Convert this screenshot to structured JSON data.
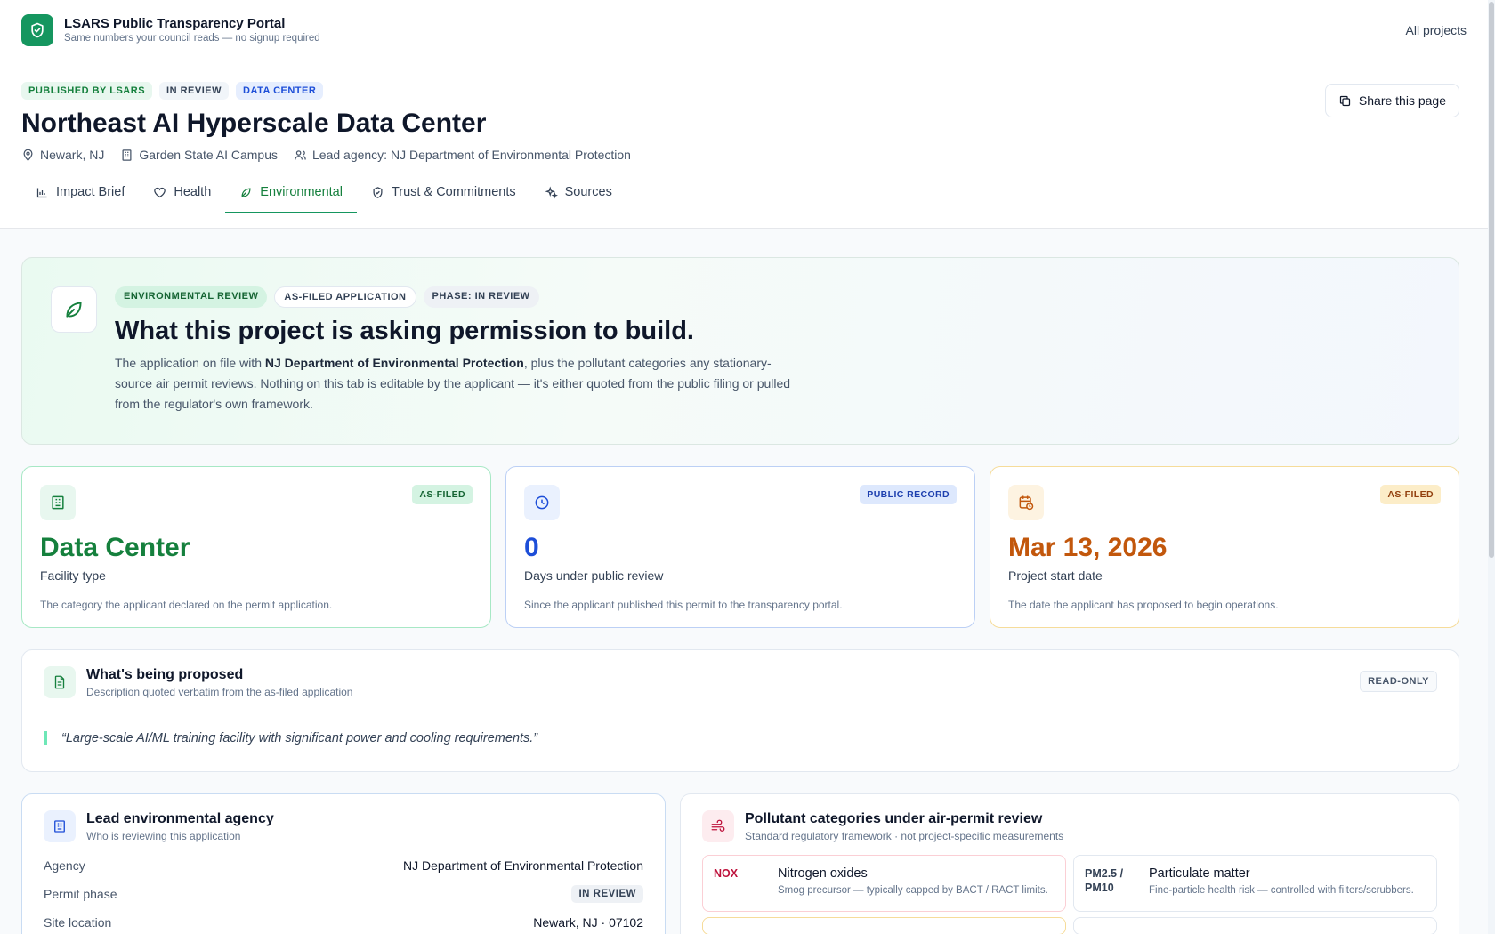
{
  "brand": {
    "title": "LSARS Public Transparency Portal",
    "subtitle": "Same numbers your council reads — no signup required"
  },
  "nav": {
    "all_projects": "All projects"
  },
  "project": {
    "badges": [
      "PUBLISHED BY LSARS",
      "IN REVIEW",
      "DATA CENTER"
    ],
    "title": "Northeast AI Hyperscale Data Center",
    "location": "Newark, NJ",
    "campus": "Garden State AI Campus",
    "lead_agency": "Lead agency: NJ Department of Environmental Protection",
    "share_label": "Share this page"
  },
  "tabs": [
    {
      "label": "Impact Brief",
      "icon": "bar-chart-icon"
    },
    {
      "label": "Health",
      "icon": "heart-icon"
    },
    {
      "label": "Environmental",
      "icon": "leaf-icon",
      "active": true
    },
    {
      "label": "Trust & Commitments",
      "icon": "shield-icon"
    },
    {
      "label": "Sources",
      "icon": "sparkles-icon"
    }
  ],
  "hero": {
    "pills": [
      "ENVIRONMENTAL REVIEW",
      "AS-FILED APPLICATION",
      "PHASE: IN REVIEW"
    ],
    "title": "What this project is asking permission to build.",
    "body_pre": "The application on file with ",
    "body_agency": "NJ Department of Environmental Protection",
    "body_post": ", plus the pollutant categories any stationary-source air permit reviews. Nothing on this tab is editable by the applicant — it's either quoted from the public filing or pulled from the regulator's own framework."
  },
  "stats": [
    {
      "tag": "AS-FILED",
      "value": "Data Center",
      "label": "Facility type",
      "desc": "The category the applicant declared on the permit application.",
      "color": "#15803d"
    },
    {
      "tag": "PUBLIC RECORD",
      "value": "0",
      "label": "Days under public review",
      "desc": "Since the applicant published this permit to the transparency portal.",
      "color": "#1d4ed8"
    },
    {
      "tag": "AS-FILED",
      "value": "Mar 13, 2026",
      "label": "Project start date",
      "desc": "The date the applicant has proposed to begin operations.",
      "color": "#c2570c"
    }
  ],
  "proposed": {
    "title": "What's being proposed",
    "subtitle": "Description quoted verbatim from the as-filed application",
    "badge": "READ-ONLY",
    "quote": "“Large-scale AI/ML training facility with significant power and cooling requirements.”"
  },
  "agency_card": {
    "title": "Lead environmental agency",
    "subtitle": "Who is reviewing this application",
    "rows": [
      {
        "key": "Agency",
        "value": "NJ Department of Environmental Protection"
      },
      {
        "key": "Permit phase",
        "value": "IN REVIEW"
      },
      {
        "key": "Site location",
        "value": "Newark, NJ · 07102"
      }
    ]
  },
  "pollutants_card": {
    "title": "Pollutant categories under air-permit review",
    "subtitle": "Standard regulatory framework · not project-specific measurements",
    "items": [
      {
        "code": "NOX",
        "name": "Nitrogen oxides",
        "desc": "Smog precursor — typically capped by BACT / RACT limits."
      },
      {
        "code": "PM2.5 / PM10",
        "name": "Particulate matter",
        "desc": "Fine-particle health risk — controlled with filters/scrubbers."
      }
    ]
  },
  "colors": {
    "accent": "#15965f",
    "blue": "#1d4ed8",
    "amber": "#c2570c",
    "red": "#be123c"
  }
}
